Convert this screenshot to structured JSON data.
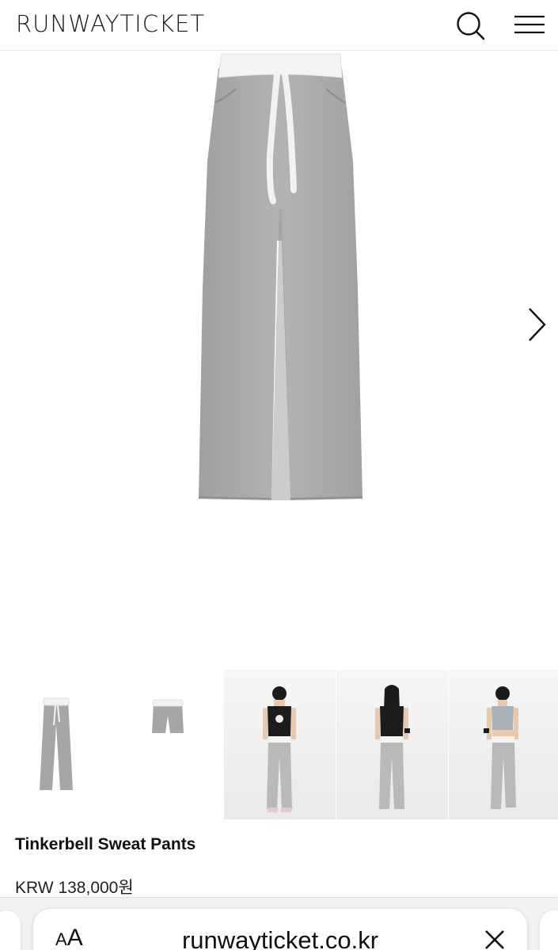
{
  "header": {
    "logo": "RUNWAYTICKET",
    "search_icon": "search-icon",
    "menu_icon": "hamburger-menu-icon"
  },
  "gallery": {
    "main_image": "grey-sweat-pants-product-photo",
    "next_icon": "chevron-right-icon",
    "thumbnails": [
      {
        "name": "pants-front-thumbnail"
      },
      {
        "name": "shorts-thumbnail"
      },
      {
        "name": "model-front-thumbnail"
      },
      {
        "name": "model-back-thumbnail"
      },
      {
        "name": "model-side-thumbnail"
      }
    ]
  },
  "product": {
    "title": "Tinkerbell Sweat Pants",
    "price": "KRW 138,000원"
  },
  "browser": {
    "text_size_label_small": "A",
    "text_size_label_large": "A",
    "url": "runwayticket.co.kr",
    "close_icon": "close-icon"
  },
  "colors": {
    "fabric_grey": "#a9a9a9",
    "waistband_white": "#f4f4f2",
    "text": "#111111"
  }
}
